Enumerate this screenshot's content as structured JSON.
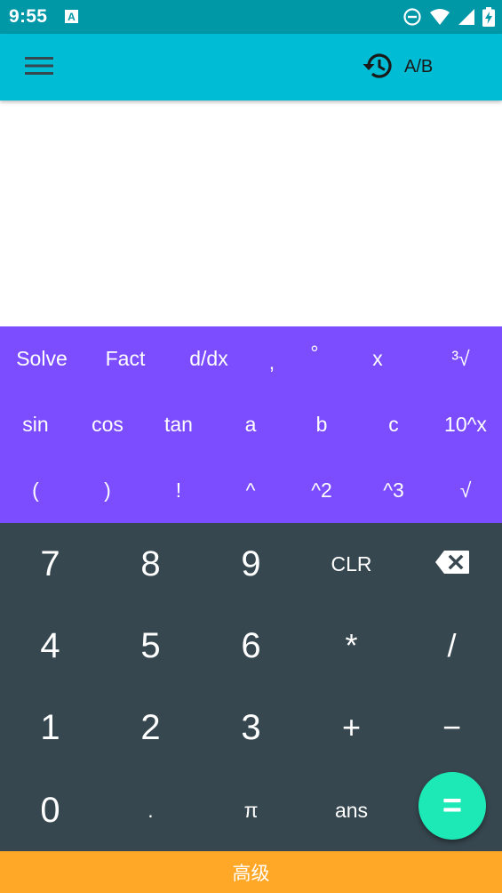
{
  "status_bar": {
    "time": "9:55",
    "notification_icon": "text-a-notification-icon",
    "icons": [
      "do-not-disturb-icon",
      "wifi-icon",
      "signal-icon",
      "battery-charging-icon"
    ]
  },
  "app_bar": {
    "menu_icon": "hamburger-menu-icon",
    "history_icon": "history-icon",
    "ab_label": "A/B",
    "ab_toggle_on": false
  },
  "display": {
    "expression": "",
    "result": ""
  },
  "scientific_keys": [
    [
      "Solve",
      "Fact",
      "d/dx",
      ",",
      "°",
      "x",
      "³√"
    ],
    [
      "sin",
      "cos",
      "tan",
      "a",
      "b",
      "c",
      "10^x"
    ],
    [
      "(",
      ")",
      "!",
      "^",
      "^2",
      "^3",
      "√"
    ]
  ],
  "number_keys": [
    [
      "7",
      "8",
      "9",
      "CLR",
      "backspace"
    ],
    [
      "4",
      "5",
      "6",
      "*",
      "/"
    ],
    [
      "1",
      "2",
      "3",
      "+",
      "−"
    ],
    [
      "0",
      ".",
      "π",
      "ans"
    ]
  ],
  "equals_label": "=",
  "advanced_label": "高级",
  "colors": {
    "status_bar": "#0097a7",
    "app_bar": "#00bcd4",
    "scientific_panel": "#7c4dff",
    "number_panel": "#37474f",
    "equals_fab": "#1de9b6",
    "advanced_bar": "#ffa726"
  }
}
